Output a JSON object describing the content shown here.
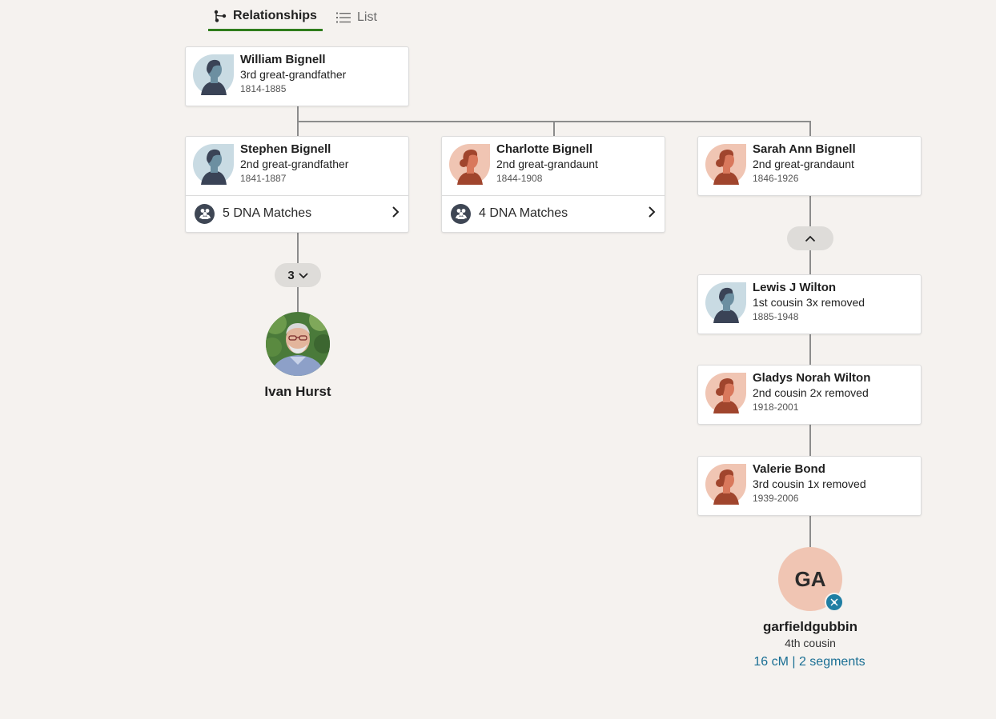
{
  "tabs": {
    "relationships_label": "Relationships",
    "list_label": "List"
  },
  "people": {
    "william": {
      "name": "William Bignell",
      "relationship": "3rd great-grandfather",
      "dates": "1814-1885",
      "avatar": "male-silhouette"
    },
    "stephen": {
      "name": "Stephen Bignell",
      "relationship": "2nd great-grandfather",
      "dates": "1841-1887",
      "avatar": "male-silhouette",
      "dna_matches": "5 DNA Matches"
    },
    "charlotte": {
      "name": "Charlotte Bignell",
      "relationship": "2nd great-grandaunt",
      "dates": "1844-1908",
      "avatar": "female-silhouette",
      "dna_matches": "4 DNA Matches"
    },
    "sarah": {
      "name": "Sarah Ann Bignell",
      "relationship": "2nd great-grandaunt",
      "dates": "1846-1926",
      "avatar": "female-silhouette"
    },
    "lewis": {
      "name": "Lewis J Wilton",
      "relationship": "1st cousin 3x removed",
      "dates": "1885-1948",
      "avatar": "male-silhouette"
    },
    "gladys": {
      "name": "Gladys Norah Wilton",
      "relationship": "2nd cousin 2x removed",
      "dates": "1918-2001",
      "avatar": "female-silhouette"
    },
    "valerie": {
      "name": "Valerie Bond",
      "relationship": "3rd cousin 1x removed",
      "dates": "1939-2006",
      "avatar": "female-silhouette"
    }
  },
  "collapsed_generations": {
    "count": "3"
  },
  "self": {
    "name": "Ivan Hurst",
    "avatar": "photo"
  },
  "match": {
    "initials": "GA",
    "username": "garfieldgubbin",
    "relationship": "4th cousin",
    "shared_dna": "16 cM | 2 segments"
  },
  "colors": {
    "background": "#f5f2ef",
    "tab_underline": "#2f7d1c",
    "connector": "#8c8c8c",
    "male_avatar_bg": "#c9dbe3",
    "female_avatar_bg": "#f0c5b3",
    "link": "#1a6f94"
  }
}
